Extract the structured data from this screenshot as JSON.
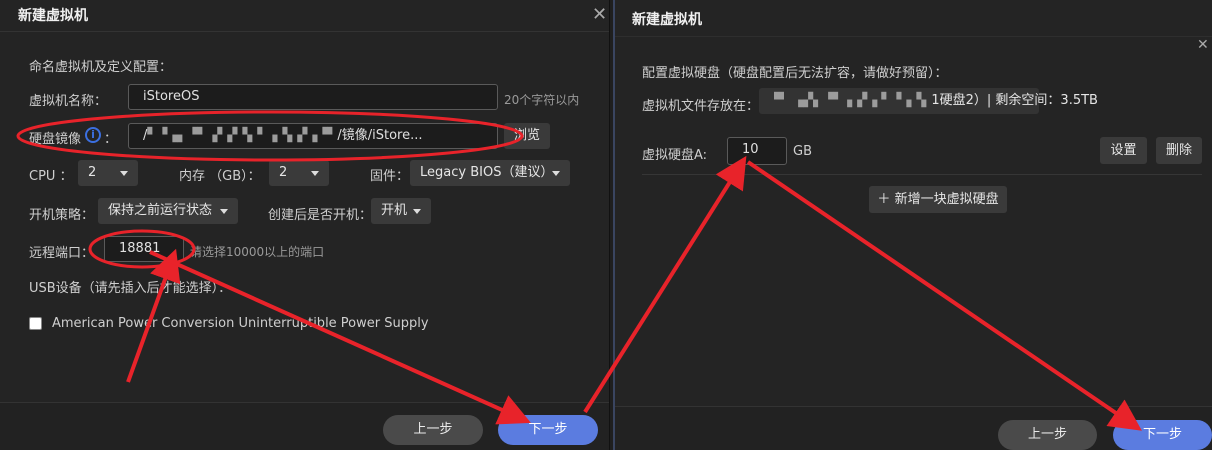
{
  "left_dialog": {
    "title": "新建虚拟机",
    "section_title": "命名虚拟机及定义配置：",
    "name_label": "虚拟机名称：",
    "name_value": "iStoreOS",
    "name_hint": "20个字符以内",
    "image_label": "硬盘镜像",
    "image_colon": "：",
    "image_value_prefix": "/",
    "image_value_blurred": "▘▝▗▖▝▘▗▘▞▝▖▘▗▝▖▞▗▝▘",
    "image_value_suffix": "/镜像/iStore...",
    "browse_label": "浏览",
    "cpu_label": "CPU ：",
    "cpu_value": "2",
    "mem_label": "内存 （GB）：",
    "mem_value": "2",
    "firmware_label": "固件：",
    "firmware_value": "Legacy BIOS（建议）",
    "boot_policy_label": "开机策略：",
    "boot_policy_value": "保持之前运行状态",
    "start_after_label": "创建后是否开机：",
    "start_after_value": "开机",
    "remote_port_label": "远程端口：",
    "remote_port_value": "18881",
    "remote_port_hint": "请选择10000以上的端口",
    "usb_label": "USB设备（请先插入后才能选择）：",
    "usb_device": "American Power Conversion Uninterruptible Power Supply",
    "prev_label": "上一步",
    "next_label": "下一步"
  },
  "right_dialog": {
    "title": "新建虚拟机",
    "section_title": "配置虚拟硬盘（硬盘配置后无法扩容，请做好预留）：",
    "storage_label": "虚拟机文件存放在：",
    "storage_value_blurred": "▝▘ ▗▞▖▝▘ ▖▞▗ ▘▝▗▝▖",
    "storage_value_suffix": "1硬盘2）| 剩余空间：3.5TB",
    "disk_label": "虚拟硬盘A:",
    "disk_value": "10",
    "disk_unit": "GB",
    "settings_label": "设置",
    "delete_label": "删除",
    "add_disk_label": "新增一块虚拟硬盘",
    "prev_label": "上一步",
    "next_label": "下一步"
  },
  "colors": {
    "annotation": "#e8232a",
    "primary_button": "#5b7ce0",
    "info_icon": "#3b6fe0"
  },
  "icons": [
    "close-icon",
    "info-icon",
    "caret-down-icon",
    "plus-icon",
    "checkbox-icon"
  ]
}
